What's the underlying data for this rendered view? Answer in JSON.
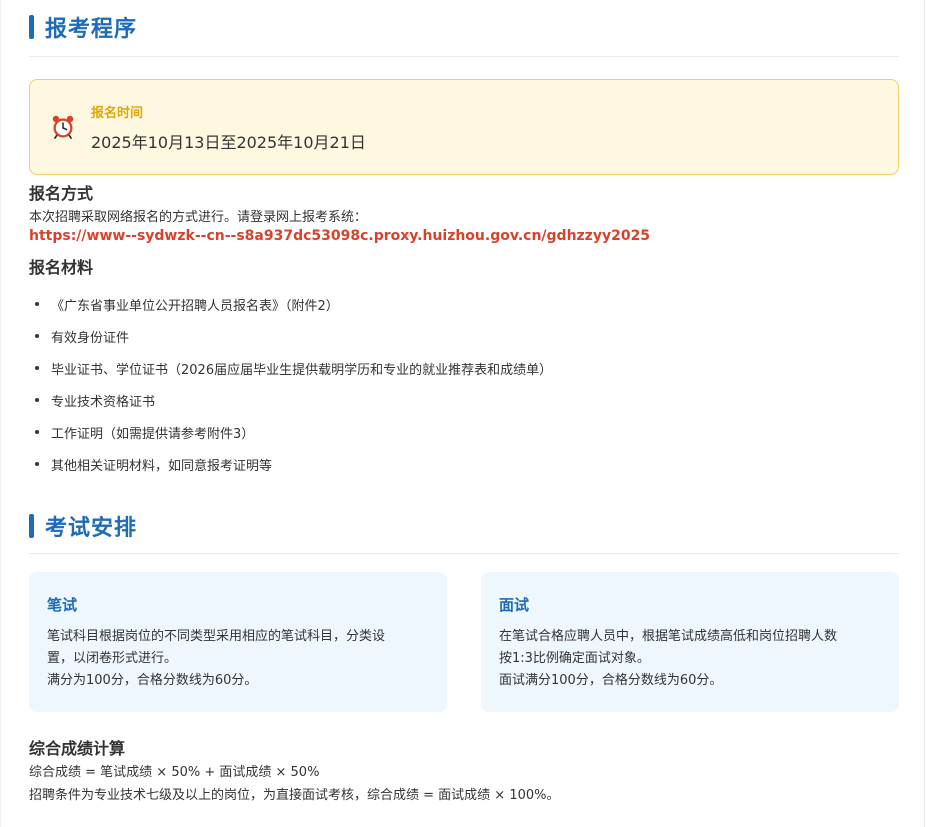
{
  "registration": {
    "title": "报考程序",
    "time_label": "报名时间",
    "time_value": "2025年10月13日至2025年10月21日",
    "method_heading": "报名方式",
    "method_text": "本次招聘采取网络报名的方式进行。请登录网上报考系统：",
    "method_link": "https://www--sydwzk--cn--s8a937dc53098c.proxy.huizhou.gov.cn/gdhzzyy2025",
    "materials_heading": "报名材料",
    "materials": [
      "《广东省事业单位公开招聘人员报名表》（附件2）",
      "有效身份证件",
      "毕业证书、学位证书（2026届应届毕业生提供载明学历和专业的就业推荐表和成绩单）",
      "专业技术资格证书",
      "工作证明（如需提供请参考附件3）",
      "其他相关证明材料，如同意报考证明等"
    ]
  },
  "exam": {
    "title": "考试安排",
    "written": {
      "title": "笔试",
      "lines": [
        "笔试科目根据岗位的不同类型采用相应的笔试科目，分类设",
        "置，以闭卷形式进行。",
        "满分为100分，合格分数线为60分。"
      ]
    },
    "interview": {
      "title": "面试",
      "lines": [
        "在笔试合格应聘人员中，根据笔试成绩高低和岗位招聘人数",
        "按1:3比例确定面试对象。",
        "面试满分100分，合格分数线为60分。"
      ]
    },
    "score_heading": "综合成绩计算",
    "score_formula": "综合成绩 = 笔试成绩 × 50% + 面试成绩 × 50%",
    "score_note": "招聘条件为专业技术七级及以上的岗位，为直接面试考核，综合成绩 = 面试成绩 × 100%。"
  },
  "colors": {
    "accent": "#1e6bb8",
    "link": "#d9412b",
    "time_label": "#e0a800",
    "time_box_bg": "#fef8e1",
    "card_bg": "#eef6fe"
  },
  "icons": {
    "alarm": "alarm-clock-icon"
  }
}
